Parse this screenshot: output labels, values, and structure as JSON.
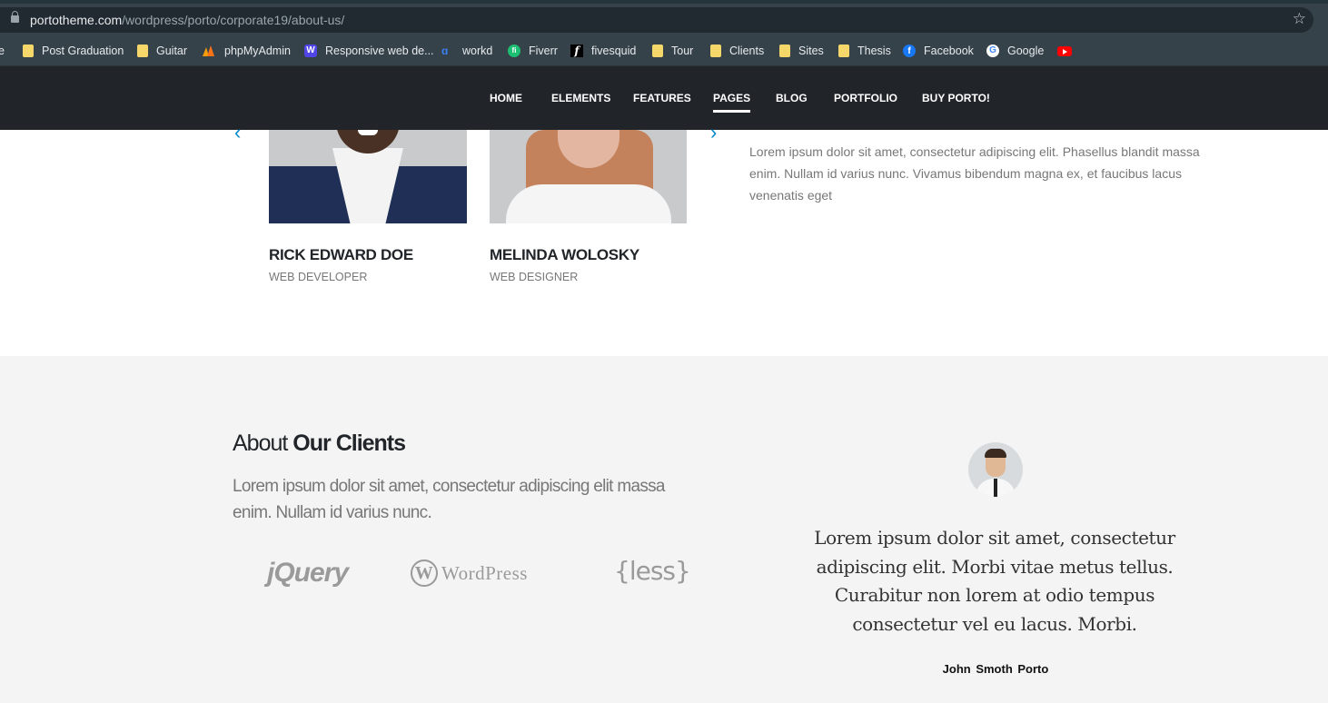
{
  "browser": {
    "url_host": "portotheme.com",
    "url_path": "/wordpress/porto/corporate19/about-us/",
    "bookmarks": [
      {
        "label": "e",
        "icon": "none"
      },
      {
        "label": "Post Graduation",
        "icon": "folder-icon"
      },
      {
        "label": "Guitar",
        "icon": "folder-icon"
      },
      {
        "label": "phpMyAdmin",
        "icon": "phpmyadmin-icon"
      },
      {
        "label": "Responsive web de...",
        "icon": "w-icon"
      },
      {
        "label": "workd",
        "icon": "workd-icon"
      },
      {
        "label": "Fiverr",
        "icon": "fiverr-icon"
      },
      {
        "label": "fivesquid",
        "icon": "fivesquid-icon"
      },
      {
        "label": "Tour",
        "icon": "folder-icon"
      },
      {
        "label": "Clients",
        "icon": "folder-icon"
      },
      {
        "label": "Sites",
        "icon": "folder-icon"
      },
      {
        "label": "Thesis",
        "icon": "folder-icon"
      },
      {
        "label": "Facebook",
        "icon": "facebook-icon"
      },
      {
        "label": "Google",
        "icon": "google-icon"
      },
      {
        "label": "",
        "icon": "youtube-icon"
      }
    ]
  },
  "nav": {
    "items": [
      "HOME",
      "ELEMENTS",
      "FEATURES",
      "PAGES",
      "BLOG",
      "PORTFOLIO",
      "BUY PORTO!"
    ],
    "active": "PAGES"
  },
  "team": {
    "members": [
      {
        "name": "RICK EDWARD DOE",
        "role": "WEB DEVELOPER"
      },
      {
        "name": "MELINDA WOLOSKY",
        "role": "WEB DESIGNER"
      }
    ],
    "prev_arrow": "‹",
    "next_arrow": "›",
    "text": "Lorem ipsum dolor sit amet, consectetur adipiscing elit. Phasellus blandit massa enim. Nullam id varius nunc. Vivamus bibendum magna ex, et faucibus lacus venenatis eget"
  },
  "clients": {
    "title_light": "About",
    "title_bold": "Our Clients",
    "text": "Lorem ipsum dolor sit amet, consectetur adipiscing elit massa enim. Nullam id varius nunc.",
    "logos": {
      "jquery": "jQuery",
      "wordpress": "WordPress",
      "less": "{less}"
    },
    "testimonial": {
      "quote": "Lorem ipsum dolor sit amet, consectetur adipiscing elit. Morbi vitae metus tellus. Curabitur non lorem at odio tempus consectetur vel eu lacus. Morbi.",
      "author": "John Smoth  Porto"
    }
  },
  "colors": {
    "nav_bg": "#212529",
    "accent": "#0088cc",
    "clients_bg": "#f4f4f4"
  }
}
